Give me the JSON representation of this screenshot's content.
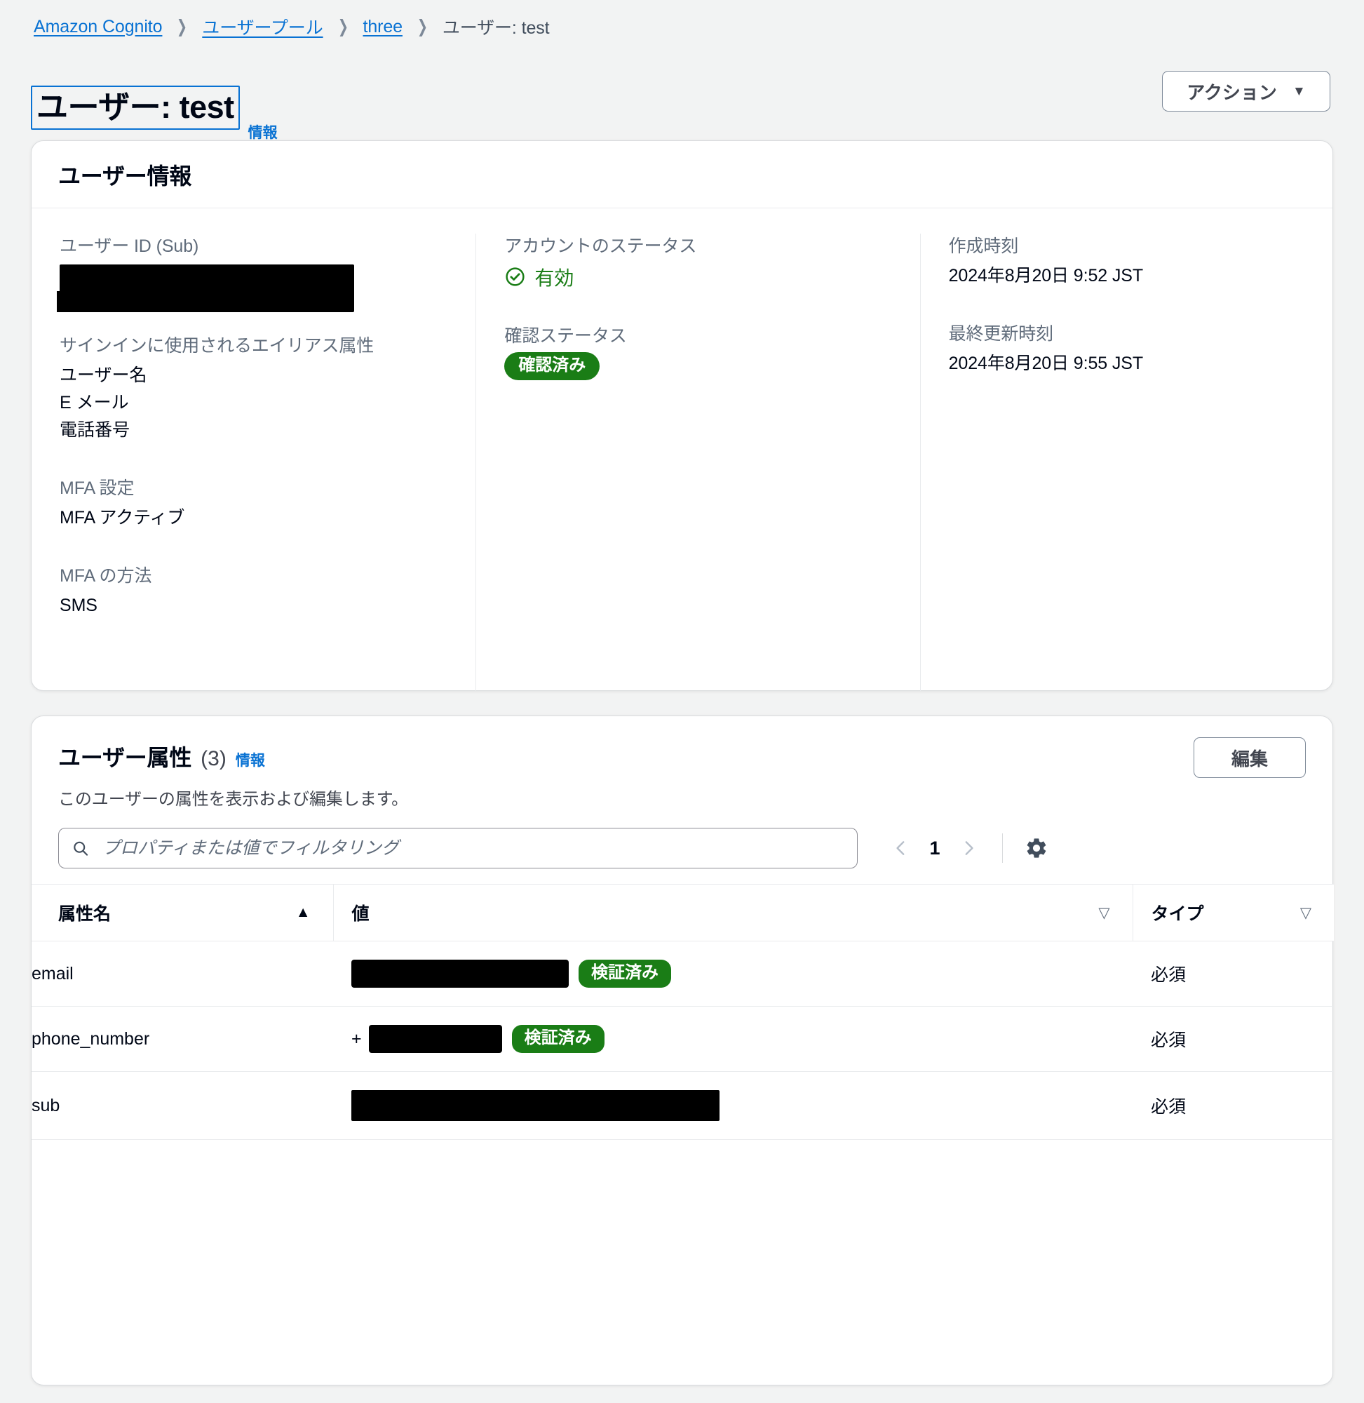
{
  "breadcrumb": [
    {
      "label": "Amazon Cognito",
      "link": true
    },
    {
      "label": "ユーザープール",
      "link": true
    },
    {
      "label": "three",
      "link": true
    },
    {
      "label": "ユーザー: test",
      "link": false
    }
  ],
  "header": {
    "title": "ユーザー: test",
    "info_label": "情報",
    "actions_label": "アクション",
    "caret": "▼"
  },
  "user_info": {
    "panel_title": "ユーザー情報",
    "sub_label": "ユーザー ID (Sub)",
    "sub_value": "",
    "alias_label": "サインインに使用されるエイリアス属性",
    "aliases": [
      "ユーザー名",
      "E メール",
      "電話番号"
    ],
    "mfa_setting_label": "MFA 設定",
    "mfa_setting_value": "MFA アクティブ",
    "mfa_method_label": "MFA の方法",
    "mfa_method_value": "SMS",
    "account_status_label": "アカウントのステータス",
    "account_status_value": "有効",
    "confirm_status_label": "確認ステータス",
    "confirm_status_value": "確認済み",
    "created_label": "作成時刻",
    "created_value": "2024年8月20日 9:52 JST",
    "updated_label": "最終更新時刻",
    "updated_value": "2024年8月20日 9:55 JST"
  },
  "attributes": {
    "title": "ユーザー属性",
    "count": "(3)",
    "info_label": "情報",
    "description": "このユーザーの属性を表示および編集します。",
    "edit_label": "編集",
    "filter_placeholder": "プロパティまたは値でフィルタリング",
    "filter_value": "",
    "page_number": "1",
    "prev_arrow": "‹",
    "next_arrow": "›",
    "columns": [
      {
        "label": "属性名",
        "sort": "asc"
      },
      {
        "label": "値",
        "sort": "desc"
      },
      {
        "label": "タイプ",
        "sort": "desc"
      }
    ],
    "rows": [
      {
        "name": "email",
        "value": "",
        "value_prefix": "",
        "verified_badge": "検証済み",
        "type": "必須"
      },
      {
        "name": "phone_number",
        "value": "",
        "value_prefix": "+",
        "verified_badge": "検証済み",
        "type": "必須"
      },
      {
        "name": "sub",
        "value": "",
        "value_prefix": "",
        "verified_badge": "",
        "type": "必須"
      }
    ]
  },
  "colors": {
    "link": "#0972d3",
    "success": "#1a7d16",
    "text": "#000716",
    "muted": "#5f6b7a",
    "background": "#f2f3f3"
  }
}
